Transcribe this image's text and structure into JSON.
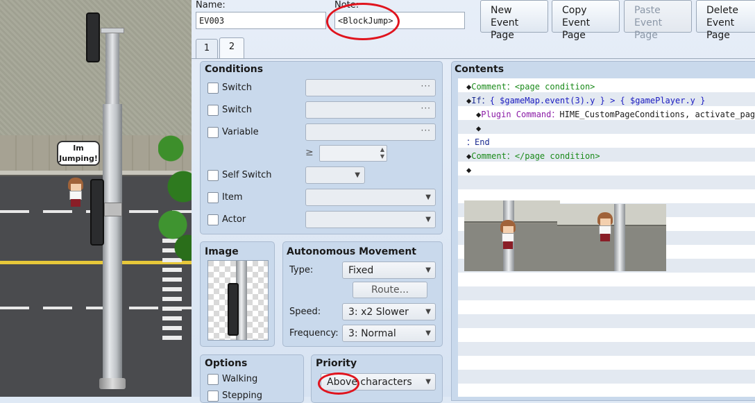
{
  "scene": {
    "speech_bubble": "Im Jumping!"
  },
  "header": {
    "name_label": "Name:",
    "name_value": "EV003",
    "note_label": "Note:",
    "note_value": "<BlockJump>",
    "buttons": {
      "new_line1": "New",
      "new_line2": "Event Page",
      "copy_line1": "Copy",
      "copy_line2": "Event Page",
      "paste_line1": "Paste",
      "paste_line2": "Event Page",
      "delete_line1": "Delete",
      "delete_line2": "Event Page"
    },
    "tabs": [
      "1",
      "2"
    ],
    "active_tab": "2"
  },
  "conditions": {
    "title": "Conditions",
    "switch1": "Switch",
    "switch2": "Switch",
    "variable": "Variable",
    "geq": "≥",
    "self_switch": "Self Switch",
    "item": "Item",
    "actor": "Actor",
    "dots": "···"
  },
  "image": {
    "title": "Image"
  },
  "autonomous": {
    "title": "Autonomous Movement",
    "type_label": "Type:",
    "type_value": "Fixed",
    "route_label": "Route...",
    "speed_label": "Speed:",
    "speed_value": "3: x2 Slower",
    "frequency_label": "Frequency:",
    "frequency_value": "3: Normal"
  },
  "options": {
    "title": "Options",
    "walking": "Walking",
    "stepping": "Stepping"
  },
  "priority": {
    "title": "Priority",
    "value": "Above characters"
  },
  "contents": {
    "title": "Contents",
    "lines": {
      "l1_marker": "◆",
      "l1_keyword": "Comment：",
      "l1_text": "<page condition>",
      "l2_marker": "◆",
      "l2_keyword": "If：",
      "l2_text": "{ $gameMap.event(3).y } > { $gamePlayer.y }",
      "l3_marker": "◆",
      "l3_keyword": "Plugin Command：",
      "l3_text": "HIME_CustomPageConditions, activate_page",
      "l4_marker": "◆",
      "l5_text": "：End",
      "l6_marker": "◆",
      "l6_keyword": "Comment：",
      "l6_text": "</page condition>",
      "l7_marker": "◆"
    }
  },
  "colors": {
    "annotation_red": "#e0141e",
    "panel_bg": "#c9d9ec",
    "comment_green": "#1a8a1a",
    "script_blue": "#1a1ac0",
    "plugin_purple": "#8a1aa6"
  },
  "icons": [
    "checkbox-icon",
    "dropdown-arrow-icon",
    "spin-arrows-icon",
    "ellipsis-icon",
    "diamond-marker-icon"
  ]
}
